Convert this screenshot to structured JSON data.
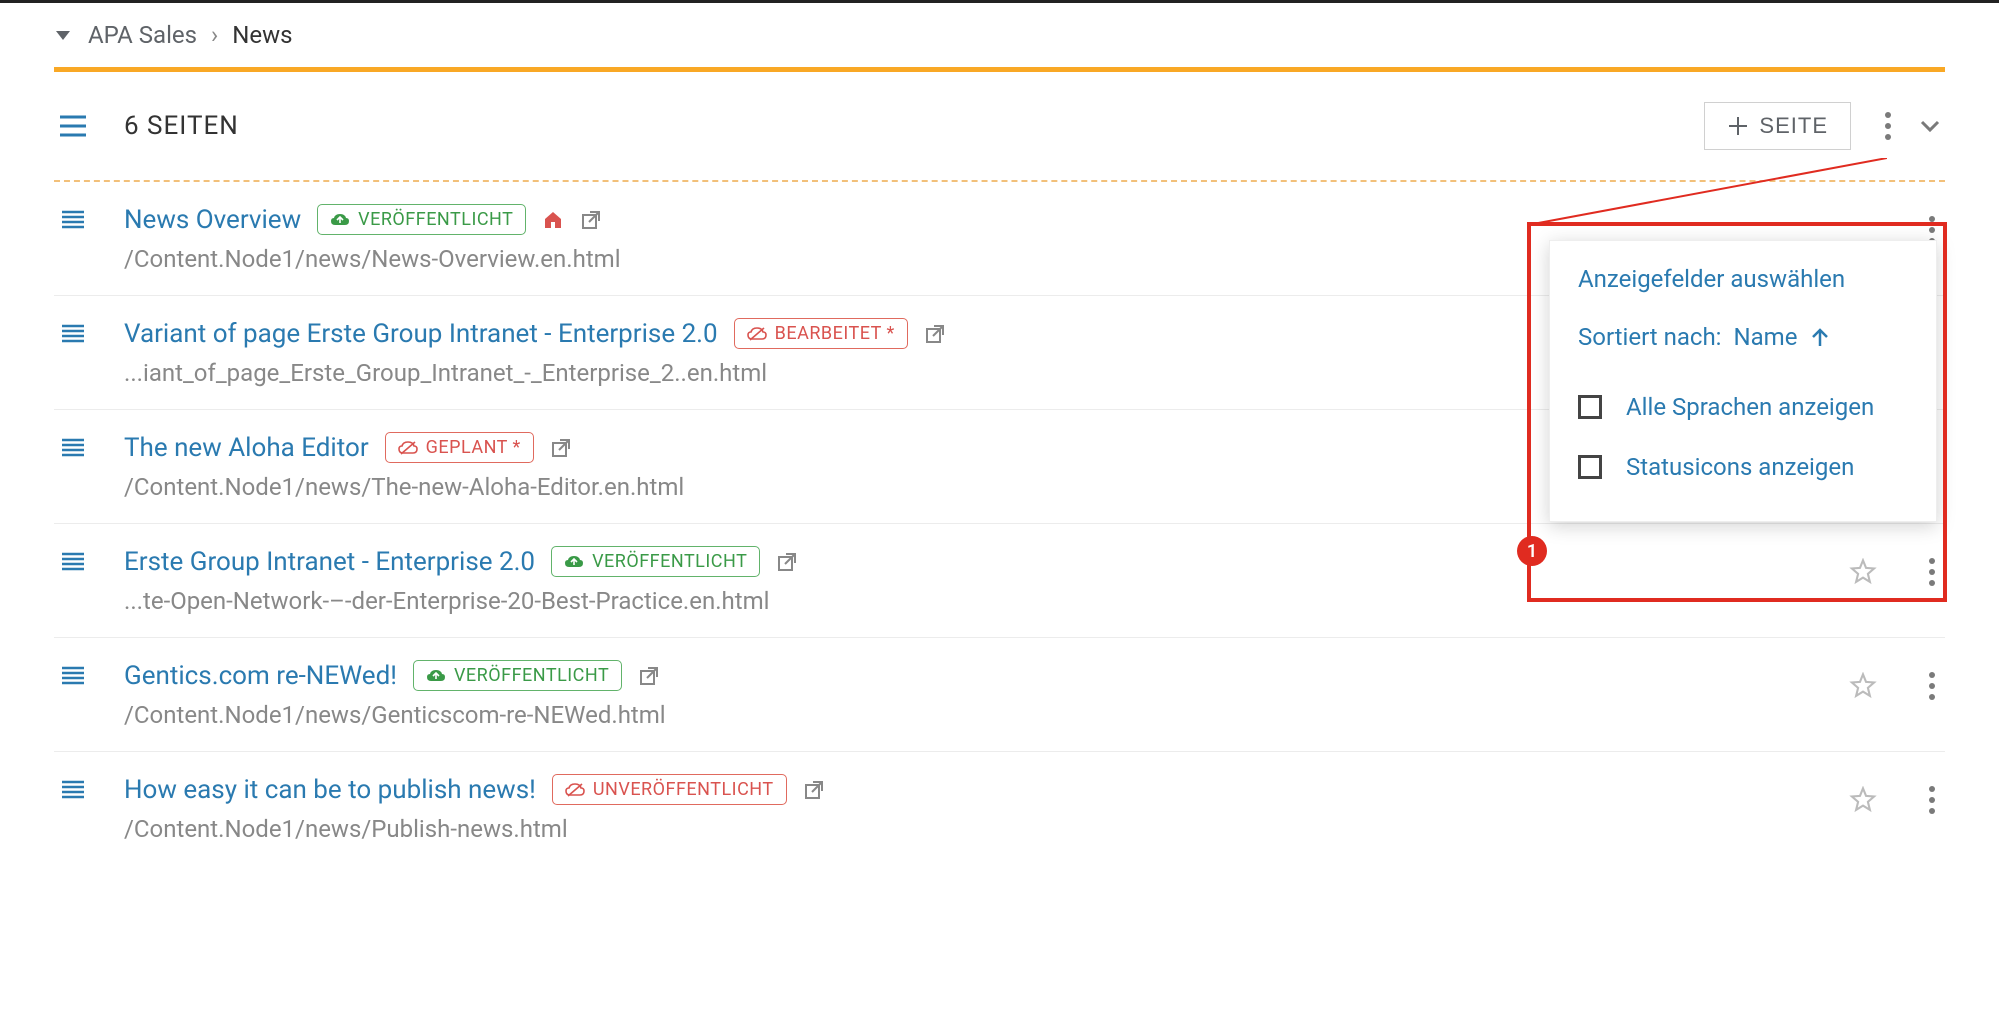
{
  "breadcrumb": {
    "node": "APA Sales",
    "current": "News",
    "separator": "›"
  },
  "section": {
    "count_label": "6 SEITEN",
    "add_button": "SEITE"
  },
  "badges": {
    "published": "VERÖFFENTLICHT",
    "edited": "BEARBEITET *",
    "planned": "GEPLANT *",
    "unpublished": "UNVERÖFFENTLICHT"
  },
  "items": [
    {
      "title": "News Overview",
      "path": "/Content.Node1/news/News-Overview.en.html",
      "status": "published",
      "home": true,
      "star": false
    },
    {
      "title": "Variant of page Erste Group Intranet - Enterprise 2.0",
      "path": "...iant_of_page_Erste_Group_Intranet_-_Enterprise_2..en.html",
      "status": "edited",
      "home": false,
      "star": false
    },
    {
      "title": "The new Aloha Editor",
      "path": "/Content.Node1/news/The-new-Aloha-Editor.en.html",
      "status": "planned",
      "home": false,
      "star": false
    },
    {
      "title": "Erste Group Intranet - Enterprise 2.0",
      "path": "...te-Open-Network-–-der-Enterprise-20-Best-Practice.en.html",
      "status": "published",
      "home": false,
      "star": true
    },
    {
      "title": "Gentics.com re-NEWed!",
      "path": "/Content.Node1/news/Genticscom-re-NEWed.html",
      "status": "published",
      "home": false,
      "star": true
    },
    {
      "title": "How easy it can be to publish news!",
      "path": "/Content.Node1/news/Publish-news.html",
      "status": "unpublished",
      "home": false,
      "star": true
    }
  ],
  "dropdown": {
    "select_fields": "Anzeigefelder auswählen",
    "sort_prefix": "Sortiert nach: ",
    "sort_field": "Name",
    "opt_all_langs": "Alle Sprachen anzeigen",
    "opt_status_icons": "Statusicons anzeigen"
  },
  "callout": {
    "number": "1"
  }
}
